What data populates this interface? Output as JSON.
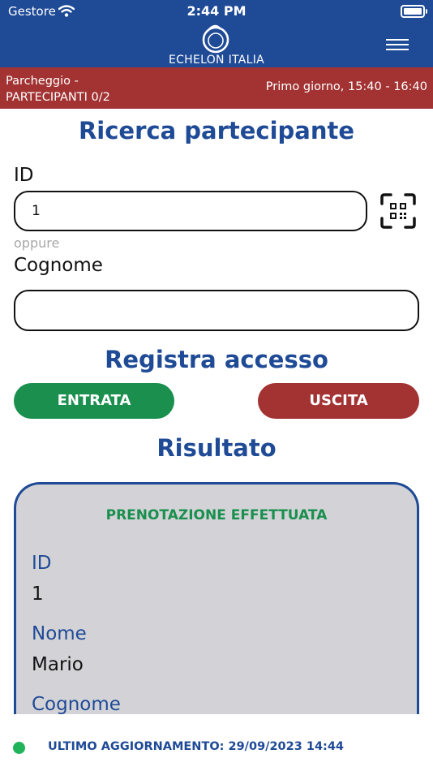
{
  "status_bar": {
    "carrier": "Gestore",
    "time": "2:44 PM",
    "wifi_icon": "wifi-icon",
    "battery_icon": "battery-icon"
  },
  "header": {
    "logo_text": "ECHELON ITALIA",
    "menu_icon": "hamburger-menu-icon"
  },
  "context": {
    "line1": "Parcheggio -",
    "line2": "PARTECIPANTI 0/2",
    "session": "Primo giorno, 15:40 - 16:40"
  },
  "search": {
    "title": "Ricerca partecipante",
    "id_label": "ID",
    "id_value": "1",
    "or_label": "oppure",
    "surname_label": "Cognome",
    "surname_value": "",
    "qr_icon": "qr-code-scan-icon"
  },
  "access": {
    "title": "Registra accesso",
    "entry_label": "ENTRATA",
    "exit_label": "USCITA"
  },
  "result": {
    "title": "Risultato",
    "status": "PRENOTAZIONE EFFETTUATA",
    "fields": [
      {
        "label": "ID",
        "value": "1"
      },
      {
        "label": "Nome",
        "value": "Mario"
      },
      {
        "label": "Cognome",
        "value": ""
      }
    ]
  },
  "footer": {
    "update_text": "ULTIMO AGGIORNAMENTO: 29/09/2023 14:44"
  },
  "colors": {
    "primary": "#1f4a96",
    "danger": "#a33333",
    "success": "#1a8f4e",
    "card_bg": "#d3d3d7"
  }
}
